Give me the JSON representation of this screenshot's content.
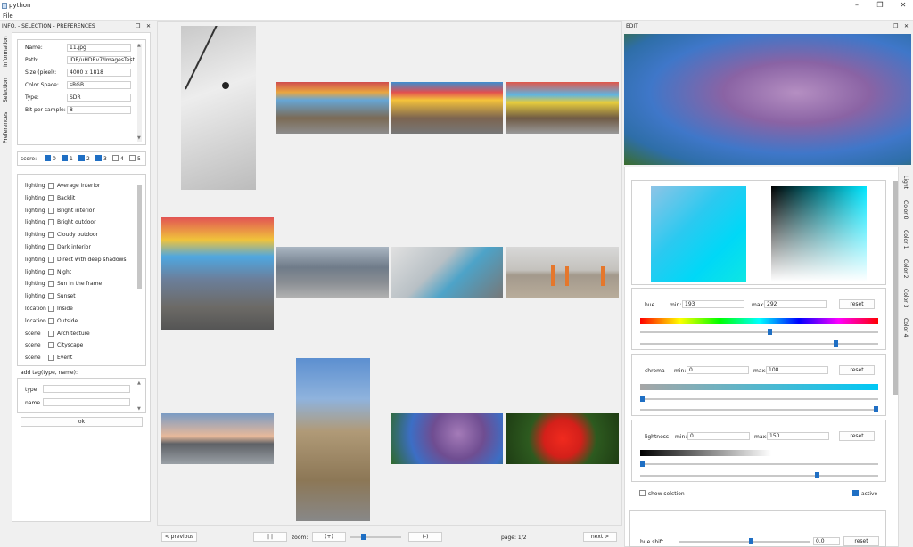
{
  "window": {
    "title": "python",
    "menu": "File"
  },
  "left_dock": {
    "title": "INFO. - SELECTION - PREFERENCES",
    "tabs": [
      "Information",
      "Selection",
      "Preferences"
    ],
    "info": [
      {
        "label": "Name:",
        "value": "11.jpg"
      },
      {
        "label": "Path:",
        "value": "IDR/uHDRv7/ImagesTest"
      },
      {
        "label": "Size (pixel):",
        "value": "4000 x 1818"
      },
      {
        "label": "Color Space:",
        "value": "sRGB"
      },
      {
        "label": "Type:",
        "value": "SDR"
      },
      {
        "label": "Bit per sample:",
        "value": "8"
      }
    ],
    "score": {
      "label": "score:",
      "items": [
        {
          "n": "0",
          "on": true
        },
        {
          "n": "1",
          "on": true
        },
        {
          "n": "2",
          "on": true
        },
        {
          "n": "3",
          "on": true
        },
        {
          "n": "4",
          "on": false
        },
        {
          "n": "5",
          "on": false
        }
      ]
    },
    "tags": [
      {
        "type": "lighting",
        "name": "Average interior"
      },
      {
        "type": "lighting",
        "name": "Backlit"
      },
      {
        "type": "lighting",
        "name": "Bright interior"
      },
      {
        "type": "lighting",
        "name": "Bright outdoor"
      },
      {
        "type": "lighting",
        "name": "Cloudy outdoor"
      },
      {
        "type": "lighting",
        "name": "Dark interior"
      },
      {
        "type": "lighting",
        "name": "Direct with deep shadows"
      },
      {
        "type": "lighting",
        "name": "Night"
      },
      {
        "type": "lighting",
        "name": "Sun in the frame"
      },
      {
        "type": "lighting",
        "name": "Sunset"
      },
      {
        "type": "location",
        "name": "Inside"
      },
      {
        "type": "location",
        "name": "Outside"
      },
      {
        "type": "scene",
        "name": "Architecture"
      },
      {
        "type": "scene",
        "name": "Cityscape"
      },
      {
        "type": "scene",
        "name": "Event"
      }
    ],
    "add_tag": {
      "title": "add tag(type, name):",
      "type_label": "type",
      "name_label": "name",
      "ok": "ok"
    }
  },
  "bottom": {
    "previous": "< previous",
    "pause": "| |",
    "zoom": "zoom:",
    "zoom_in": "(+)",
    "zoom_out": "(-)",
    "zoom_level": 0.25,
    "page": "page: 1/2",
    "next": "next >"
  },
  "right_dock": {
    "title": "EDIT",
    "tabs": [
      "Light",
      "Color 0",
      "Color 1",
      "Color 2",
      "Color 3",
      "Color 4"
    ],
    "hue": {
      "label": "hue",
      "min_label": "min:",
      "min": "193",
      "max_label": "max:",
      "max": "292",
      "reset": "reset",
      "knob_min": 193,
      "knob_max": 292
    },
    "chroma": {
      "label": "chroma",
      "min_label": "min:",
      "min": "0",
      "max_label": "max:",
      "max": "108",
      "reset": "reset"
    },
    "lightness": {
      "label": "lightness",
      "min_label": "min:",
      "min": "0",
      "max_label": "max:",
      "max": "150",
      "reset": "reset"
    },
    "show_selection": "show selction",
    "active": "active",
    "hue_shift": {
      "label": "hue shift",
      "value": "0.0",
      "reset": "reset"
    }
  },
  "colors": {
    "accent": "#1f6fc4"
  }
}
